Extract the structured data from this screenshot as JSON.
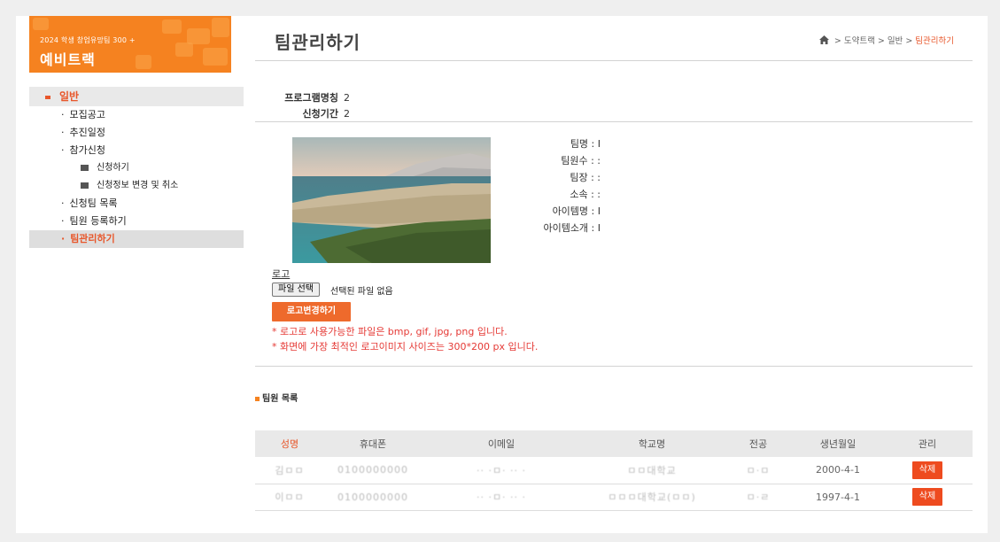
{
  "logo": {
    "subtitle": "2024 학생 창업유망팀 300 +",
    "title": "예비트랙"
  },
  "sidebar": {
    "category": "일반",
    "items": [
      {
        "label": "모집공고",
        "level": 1
      },
      {
        "label": "추진일정",
        "level": 1
      },
      {
        "label": "참가신청",
        "level": 1
      },
      {
        "label": "신청하기",
        "level": 2
      },
      {
        "label": "신청정보 변경 및 취소",
        "level": 2
      },
      {
        "label": "신청팀 목록",
        "level": 1
      },
      {
        "label": "팀원 등록하기",
        "level": 1
      },
      {
        "label": "팀관리하기",
        "level": 1,
        "active": true
      }
    ]
  },
  "page": {
    "title": "팀관리하기"
  },
  "breadcrumb": {
    "sep": " > ",
    "parts": [
      "도약트랙",
      "일반"
    ],
    "current": "팀관리하기"
  },
  "program": {
    "label": "프로그램명칭",
    "value": "2"
  },
  "period": {
    "label": "신청기간",
    "value": "2"
  },
  "details": {
    "team_name": "팀명 : I",
    "member_count": "팀원수 : :",
    "leader": "팀장 : :",
    "affiliation": "소속 : :",
    "item_name": "아이템명 : I",
    "item_intro": "아이템소개 : I"
  },
  "logo_section": {
    "label": "로고",
    "file_button": "파일 선택",
    "file_status": "선택된 파일 없음",
    "change_button": "로고변경하기",
    "note1": "* 로고로 사용가능한 파일은 bmp, gif, jpg, png 입니다.",
    "note2": "* 화면에 가장 최적인 로고이미지 사이즈는 300*200 px 입니다."
  },
  "members": {
    "section_title": "팀원 목록",
    "columns": [
      "성명",
      "휴대폰",
      "이메일",
      "학교명",
      "전공",
      "생년월일",
      "관리"
    ],
    "rows": [
      {
        "name": "김ㅁㅁ",
        "phone": "0100000000",
        "email": "·· ·ㅁ· ·· ·",
        "school": "ㅁㅁ대학교",
        "major": "ㅁ·ㅁ",
        "birth": "2000-4-1",
        "action": "삭제"
      },
      {
        "name": "이ㅁㅁ",
        "phone": "0100000000",
        "email": "·· ·ㅁ· ·· ·",
        "school": "ㅁㅁㅁ대학교(ㅁㅁ)",
        "major": "ㅁ·ㄹ",
        "birth": "1997-4-1",
        "action": "삭제"
      }
    ]
  },
  "colors": {
    "accent": "#f58220",
    "active": "#e8562a",
    "danger": "#e53935"
  }
}
